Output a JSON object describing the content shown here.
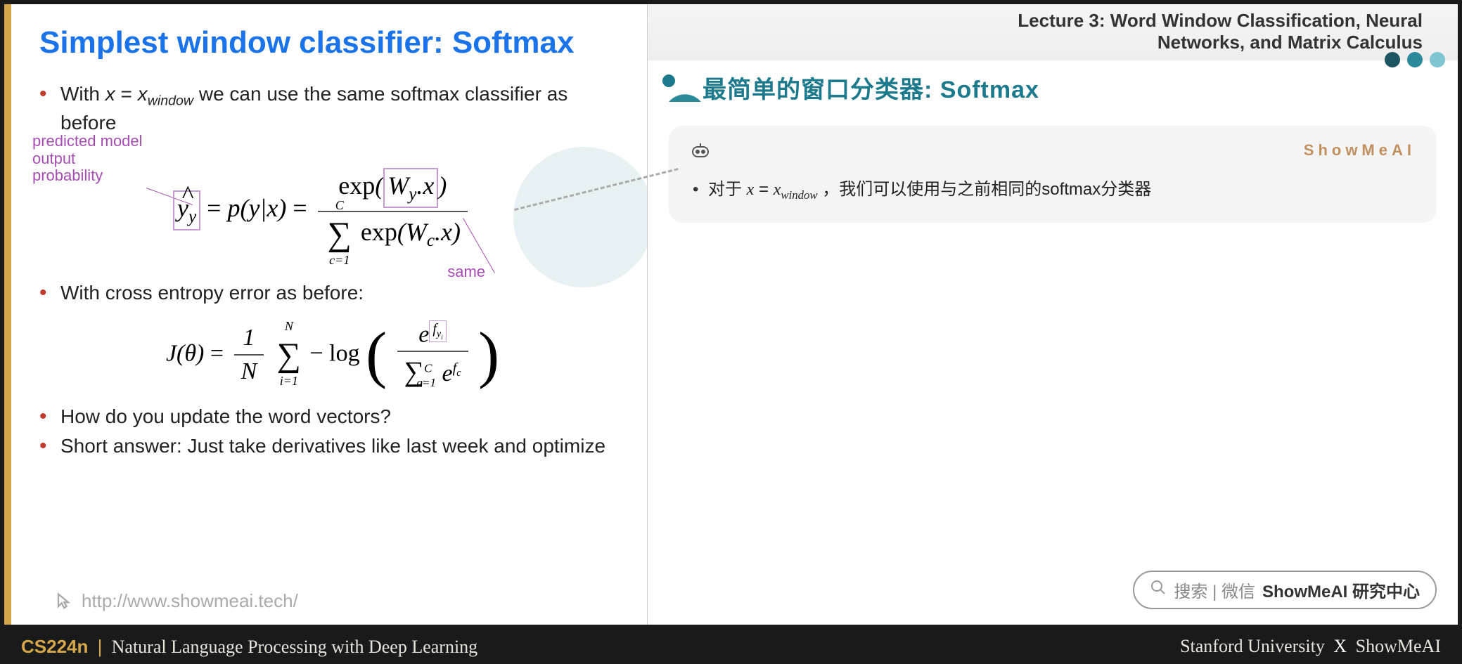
{
  "slide": {
    "title": "Simplest window classifier: Softmax",
    "bullets": {
      "b1_prefix": "With ",
      "b1_var": "x",
      "b1_eq": " = ",
      "b1_var2": "x",
      "b1_sub": "window",
      "b1_suffix": " we can use the same softmax classifier as before",
      "b2": "With cross entropy error as before:",
      "b3": "How do you update the word vectors?",
      "b4": "Short answer: Just take derivatives like last week and optimize"
    },
    "annotations": {
      "predicted": "predicted model\noutput\nprobability",
      "same": "same"
    },
    "formula1": {
      "lhs_y": "y",
      "lhs_sub": "y",
      "py": "p(y|x)",
      "exp": "exp",
      "W": "W",
      "Wy_sub": "y",
      "dot_x": ".x",
      "sum_c": "c=1",
      "sum_C": "C",
      "Wc_sub": "c"
    },
    "formula2": {
      "J": "J(θ)",
      "one": "1",
      "N": "N",
      "i1": "i=1",
      "minus_log": "− log",
      "e": "e",
      "fyi": "f",
      "fyi_sub": "y",
      "fyi_subsub": "i",
      "c1": "c=1",
      "C": "C",
      "fc": "f",
      "fc_sub": "c"
    },
    "url": "http://www.showmeai.tech/"
  },
  "right": {
    "lecture_line1": "Lecture 3:  Word Window Classification, Neural",
    "lecture_line2": "Networks, and Matrix Calculus",
    "cn_title": "最简单的窗口分类器: Softmax",
    "brand": "ShowMeAI",
    "note_prefix": "对于 ",
    "note_math_x": "x",
    "note_math_eq": " = ",
    "note_math_x2": "x",
    "note_math_sub": "window",
    "note_suffix": " ，我们可以使用与之前相同的softmax分类器",
    "search_label": "搜索 | 微信",
    "search_bold": "ShowMeAI 研究中心"
  },
  "footer": {
    "code": "CS224n",
    "sep": "|",
    "course": "Natural Language Processing with Deep Learning",
    "uni": "Stanford University",
    "x": "X",
    "brand": "ShowMeAI"
  }
}
